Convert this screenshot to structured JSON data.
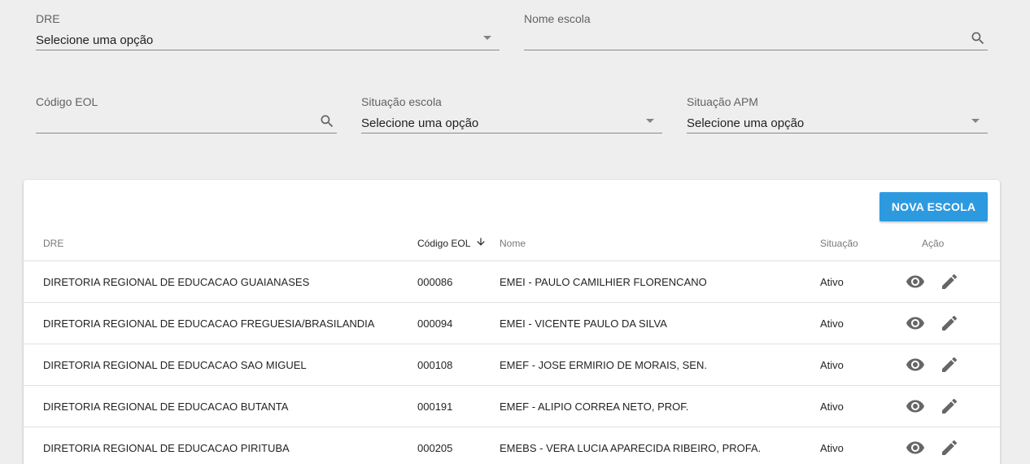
{
  "filters": {
    "dre": {
      "label": "DRE",
      "value": "Selecione uma opção"
    },
    "nome_escola": {
      "label": "Nome escola",
      "value": ""
    },
    "codigo_eol": {
      "label": "Código EOL",
      "value": ""
    },
    "situacao_escola": {
      "label": "Situação escola",
      "value": "Selecione uma opção"
    },
    "situacao_apm": {
      "label": "Situação APM",
      "value": "Selecione uma opção"
    }
  },
  "toolbar": {
    "new_label": "NOVA ESCOLA",
    "accent": "#2d9ae0"
  },
  "table": {
    "headers": {
      "dre": "DRE",
      "codigo": "Código EOL",
      "nome": "Nome",
      "situacao": "Situação",
      "acao": "Ação"
    },
    "sort": {
      "column": "codigo",
      "icon": "arrow-down-icon"
    },
    "rows": [
      {
        "dre": "DIRETORIA REGIONAL DE EDUCACAO GUAIANASES",
        "codigo": "000086",
        "nome": "EMEI - PAULO CAMILHIER FLORENCANO",
        "situacao": "Ativo"
      },
      {
        "dre": "DIRETORIA REGIONAL DE EDUCACAO FREGUESIA/BRASILANDIA",
        "codigo": "000094",
        "nome": "EMEI - VICENTE PAULO DA SILVA",
        "situacao": "Ativo"
      },
      {
        "dre": "DIRETORIA REGIONAL DE EDUCACAO SAO MIGUEL",
        "codigo": "000108",
        "nome": "EMEF - JOSE ERMIRIO DE MORAIS, SEN.",
        "situacao": "Ativo"
      },
      {
        "dre": "DIRETORIA REGIONAL DE EDUCACAO BUTANTA",
        "codigo": "000191",
        "nome": "EMEF - ALIPIO CORREA NETO, PROF.",
        "situacao": "Ativo"
      },
      {
        "dre": "DIRETORIA REGIONAL DE EDUCACAO PIRITUBA",
        "codigo": "000205",
        "nome": "EMEBS - VERA LUCIA APARECIDA RIBEIRO, PROFA.",
        "situacao": "Ativo"
      }
    ],
    "row_actions": [
      "eye-icon",
      "pencil-icon"
    ]
  }
}
